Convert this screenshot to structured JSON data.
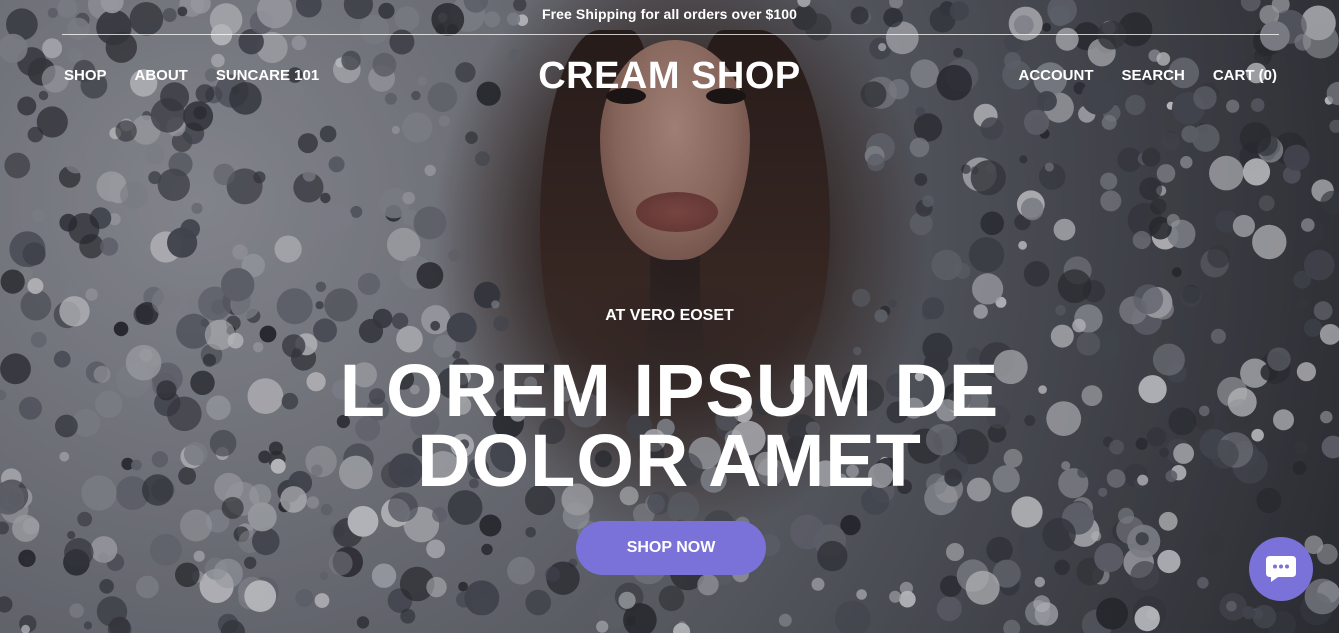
{
  "announcement": "Free Shipping for all orders over $100",
  "header": {
    "logo": "CREAM SHOP",
    "nav_left": [
      "SHOP",
      "ABOUT",
      "SUNCARE 101"
    ],
    "nav_right": [
      "ACCOUNT",
      "SEARCH",
      "CART (0)"
    ]
  },
  "hero": {
    "kicker": "AT VERO EOSET",
    "headline_line1": "LOREM IPSUM DE",
    "headline_line2": "DOLOR AMET",
    "cta_label": "SHOP NOW"
  },
  "colors": {
    "accent": "#7a72d8",
    "text": "#ffffff"
  },
  "icons": {
    "chat": "chat-bubble-icon"
  }
}
